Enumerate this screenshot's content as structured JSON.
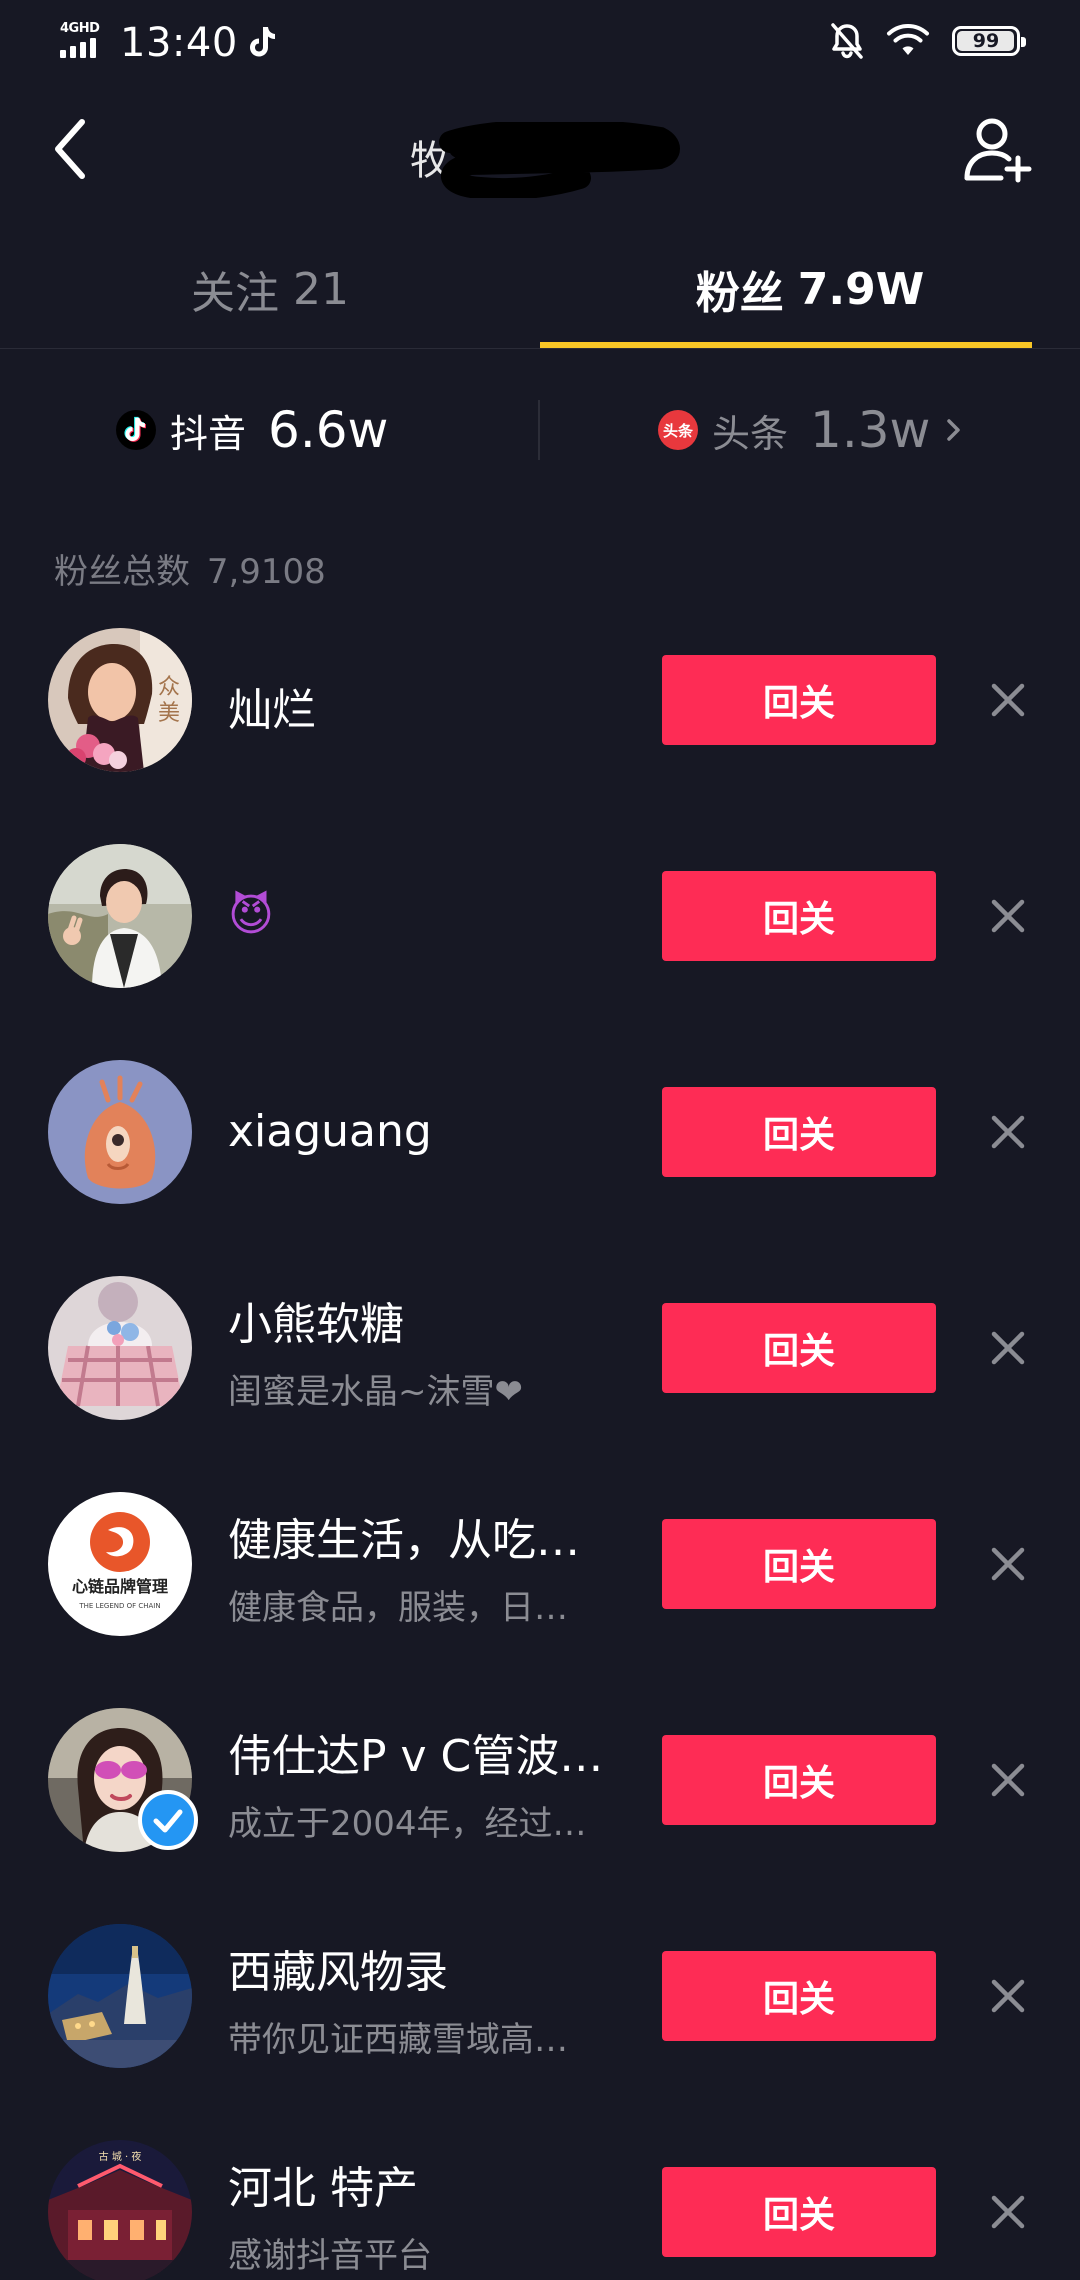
{
  "status_bar": {
    "network": "4GHD",
    "time": "13:40",
    "battery": "99",
    "battery_level": 0.99
  },
  "nav": {
    "title": "牧"
  },
  "tabs": [
    {
      "label": "关注",
      "count": "21",
      "active": false
    },
    {
      "label": "粉丝",
      "count": "7.9W",
      "active": true
    }
  ],
  "platforms": [
    {
      "name": "抖音",
      "count": "6.6w"
    },
    {
      "name": "头条",
      "count": "1.3w",
      "icon_text": "头条"
    }
  ],
  "fans_total": {
    "label": "粉丝总数",
    "value": "7,9108"
  },
  "follow_back_label": "回关",
  "fans": [
    {
      "name": "灿烂",
      "bio": "",
      "verified": false,
      "avatar": "woman-portrait"
    },
    {
      "name": "😈",
      "bio": "",
      "verified": false,
      "avatar": "woman-vest"
    },
    {
      "name": "xiaguang",
      "bio": "",
      "verified": false,
      "avatar": "cartoon-creature"
    },
    {
      "name": "小熊软糖",
      "bio": "闺蜜是水晶~沫雪❤",
      "verified": false,
      "avatar": "plaid-skirt"
    },
    {
      "name": "健康生活，从吃…",
      "bio": "健康食品，服装，日…",
      "verified": false,
      "avatar": "brand-logo",
      "avatar_text": "心链品牌管理",
      "avatar_subtext": "THE LEGEND OF CHAIN"
    },
    {
      "name": "伟仕达P v C管波…",
      "bio": "成立于2004年，经过…",
      "verified": true,
      "avatar": "woman-sunglasses"
    },
    {
      "name": "西藏风物录",
      "bio": "带你见证西藏雪域高…",
      "verified": false,
      "avatar": "potala-night"
    },
    {
      "name": "河北 特产",
      "bio": "感谢抖音平台",
      "verified": false,
      "avatar": "old-town-night"
    }
  ]
}
